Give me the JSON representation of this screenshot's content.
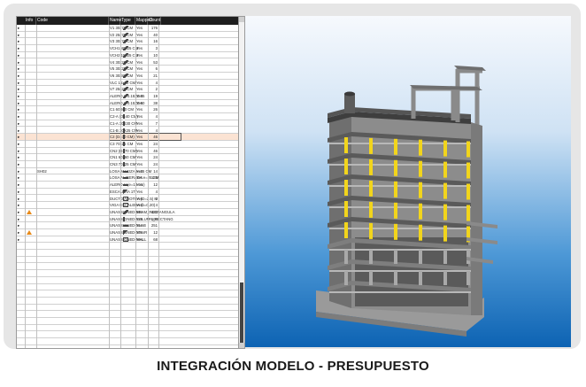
{
  "table": {
    "columns": [
      "Info",
      "Code",
      "Name",
      "Type",
      "Mapped",
      "Count"
    ],
    "rows": [
      {
        "code": "",
        "name": "V1 30x70 CM",
        "type": "beam",
        "mapped": "Yes",
        "count": "176"
      },
      {
        "code": "",
        "name": "V2 25x70 CM",
        "type": "beam",
        "mapped": "Yes",
        "count": "40"
      },
      {
        "code": "",
        "name": "V3 30x70 CM",
        "type": "beam",
        "mapped": "Yes",
        "count": "16"
      },
      {
        "code": "",
        "name": "VCH1 40x25 CM",
        "type": "beam",
        "mapped": "Yes",
        "count": "3"
      },
      {
        "code": "",
        "name": "VCH2 15x25 CM",
        "type": "beam",
        "mapped": "Yes",
        "count": "10"
      },
      {
        "code": "",
        "name": "V4 30x25 CM",
        "type": "beam",
        "mapped": "Yes",
        "count": "53"
      },
      {
        "code": "",
        "name": "V5 30x25 CM",
        "type": "beam",
        "mapped": "Yes",
        "count": "6"
      },
      {
        "code": "",
        "name": "V6 30x80 CM",
        "type": "beam",
        "mapped": "Yes",
        "count": "21"
      },
      {
        "code": "",
        "name": "VLC 15x70 CM",
        "type": "beam",
        "mapped": "Yes",
        "count": "4"
      },
      {
        "code": "",
        "name": "V7 25x20 CM",
        "type": "beam",
        "mapped": "Yes",
        "count": "2"
      },
      {
        "code": "",
        "name": "ALERO V 0.15X0.35",
        "type": "beam",
        "mapped": "Yes",
        "count": "19"
      },
      {
        "code": "",
        "name": "ALERO V 0.15X0.60",
        "type": "beam",
        "mapped": "Yes",
        "count": "38"
      },
      {
        "code": "",
        "name": "C1 60X60 CM",
        "type": "column",
        "mapped": "Yes",
        "count": "26"
      },
      {
        "code": "",
        "name": "C2-A (D=40 CM)",
        "type": "column",
        "mapped": "Yes",
        "count": "4"
      },
      {
        "code": "",
        "name": "C1-A 30X30 CM",
        "type": "column",
        "mapped": "Yes",
        "count": "7"
      },
      {
        "code": "",
        "name": "C1-B 30X25 CM",
        "type": "column",
        "mapped": "Yes",
        "count": "4"
      },
      {
        "code": "",
        "name": "C2 (D=70 CM)",
        "type": "column",
        "mapped": "Yes",
        "count": "46"
      },
      {
        "code": "",
        "name": "C3 70x25 CM",
        "type": "column",
        "mapped": "Yes",
        "count": "24"
      },
      {
        "code": "",
        "name": "CN2 (D=70 CM)",
        "type": "column",
        "mapped": "Yes",
        "count": "46"
      },
      {
        "code": "",
        "name": "CN1 60x60 CM",
        "type": "column",
        "mapped": "Yes",
        "count": "24"
      },
      {
        "code": "",
        "name": "CN3 70x25 CM",
        "type": "column",
        "mapped": "Yes",
        "count": "24"
      },
      {
        "code": "",
        "name": "LOSA MACIZA e=25 CM",
        "type": "slab",
        "mapped": "Yes",
        "count": "14"
      },
      {
        "code": "",
        "name": "LOSA ALIGERADA e=25 CM",
        "type": "slab",
        "mapped": "Yes",
        "count": "135"
      },
      {
        "code": "",
        "name": "ALERO H (e=15 cm)",
        "type": "slab",
        "mapped": "Yes",
        "count": "12"
      },
      {
        "code": "",
        "name": "ESCALERA 1T",
        "type": "stair",
        "mapped": "Yes",
        "count": "4"
      },
      {
        "code": "",
        "name": "DUCTO ADOTEA (D=2.5) M",
        "type": "wall",
        "mapped": "Yes",
        "count": "2"
      },
      {
        "code": "",
        "name": "VIGA ESCALERA (b=0.20)",
        "type": "wall",
        "mapped": "Yes",
        "count": "4"
      },
      {
        "code": "",
        "name": "UNASSIGNED-BEAM_RECTANGULA",
        "type": "beam",
        "mapped": "Yes",
        "count": "436",
        "warn": true
      },
      {
        "code": "",
        "name": "UNASSIGNED-COLUMN_RECTANG",
        "type": "column",
        "mapped": "Yes",
        "count": "160"
      },
      {
        "code": "",
        "name": "UNASSIGNED-SLAB",
        "type": "slab",
        "mapped": "Yes",
        "count": "251"
      },
      {
        "code": "",
        "name": "UNASSIGNED-STAIR",
        "type": "stair",
        "mapped": "Yes",
        "count": "12",
        "warn": true
      },
      {
        "code": "",
        "name": "UNASSIGNED-WALL",
        "type": "wall",
        "mapped": "Yes",
        "count": "68"
      }
    ],
    "group_code": "SH02",
    "selected_row": 16
  },
  "colors": {
    "selection": "#fbe3d3",
    "warning": "#e88a1a",
    "column_highlight": "#f2d51c",
    "viewport_top": "#f6f9fd",
    "viewport_bottom": "#0d63b3"
  },
  "caption": "INTEGRACIÓN MODELO - PRESUPUESTO"
}
